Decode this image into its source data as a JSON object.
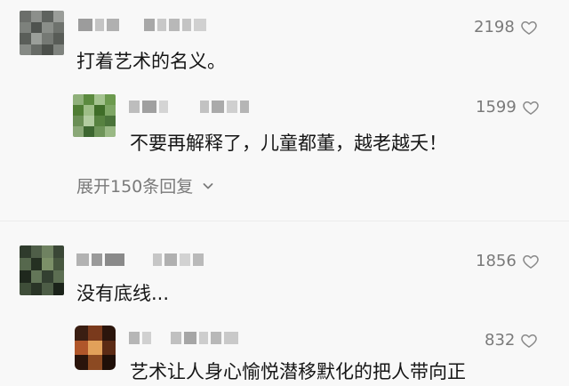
{
  "comments": [
    {
      "text": "打着艺术的名义。",
      "likes": "2198",
      "icon": "heart-outline-icon",
      "reply": {
        "text": "不要再解释了，儿童都董，越老越夭！",
        "likes": "1599",
        "icon": "heart-outline-icon"
      },
      "expand_label": "展开150条回复"
    },
    {
      "text": "没有底线...",
      "likes": "1856",
      "icon": "heart-outline-icon",
      "reply": {
        "text": "艺术让人身心愉悦潜移默化的把人带向正",
        "likes": "832",
        "icon": "heart-outline-icon"
      }
    }
  ],
  "colors": {
    "background": "#f8f8f8",
    "text": "#161616",
    "muted": "#7a7a7a"
  }
}
